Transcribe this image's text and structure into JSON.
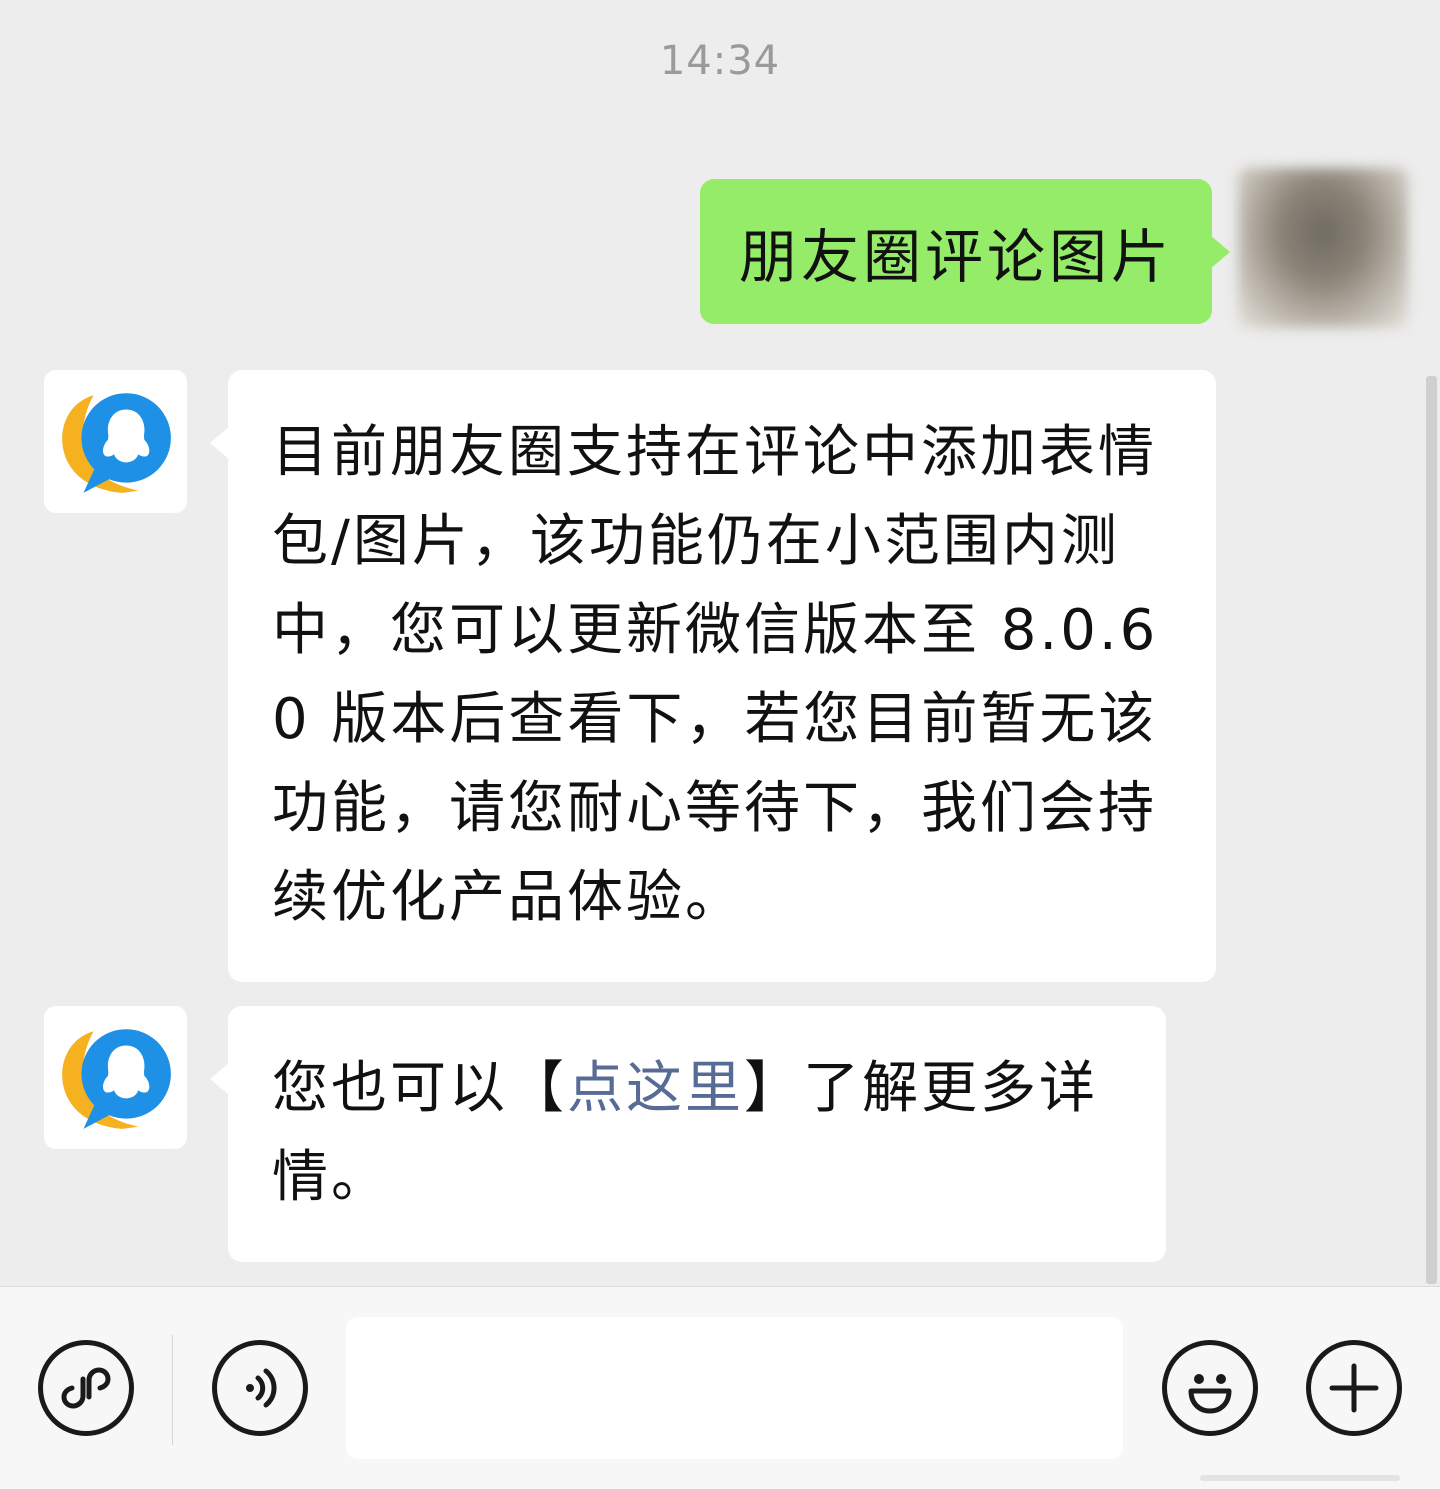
{
  "chat": {
    "timestamp": "14:34",
    "messages": [
      {
        "direction": "outgoing",
        "text": "朋友圈评论图片"
      },
      {
        "direction": "incoming",
        "sender_avatar_icon": "qq-penguin-icon",
        "text": "目前朋友圈支持在评论中添加表情包/图片，该功能仍在小范围内测中，您可以更新微信版本至 8.0.60 版本后查看下，若您目前暂无该功能，请您耐心等待下，我们会持续优化产品体验。"
      },
      {
        "direction": "incoming",
        "sender_avatar_icon": "qq-penguin-icon",
        "text_before_link": "您也可以【",
        "link_text": "点这里",
        "text_after_link": "】了解更多详情。"
      }
    ]
  },
  "input_bar": {
    "left_icons": [
      "mini-program-icon",
      "voice-icon"
    ],
    "input_value": "",
    "right_icons": [
      "emoji-icon",
      "plus-icon"
    ]
  },
  "colors": {
    "background": "#ededed",
    "outgoing_bubble": "#95ec69",
    "incoming_bubble": "#ffffff",
    "link": "#576b95",
    "avatar_blue": "#1e90e6",
    "avatar_yellow": "#f5b120"
  }
}
